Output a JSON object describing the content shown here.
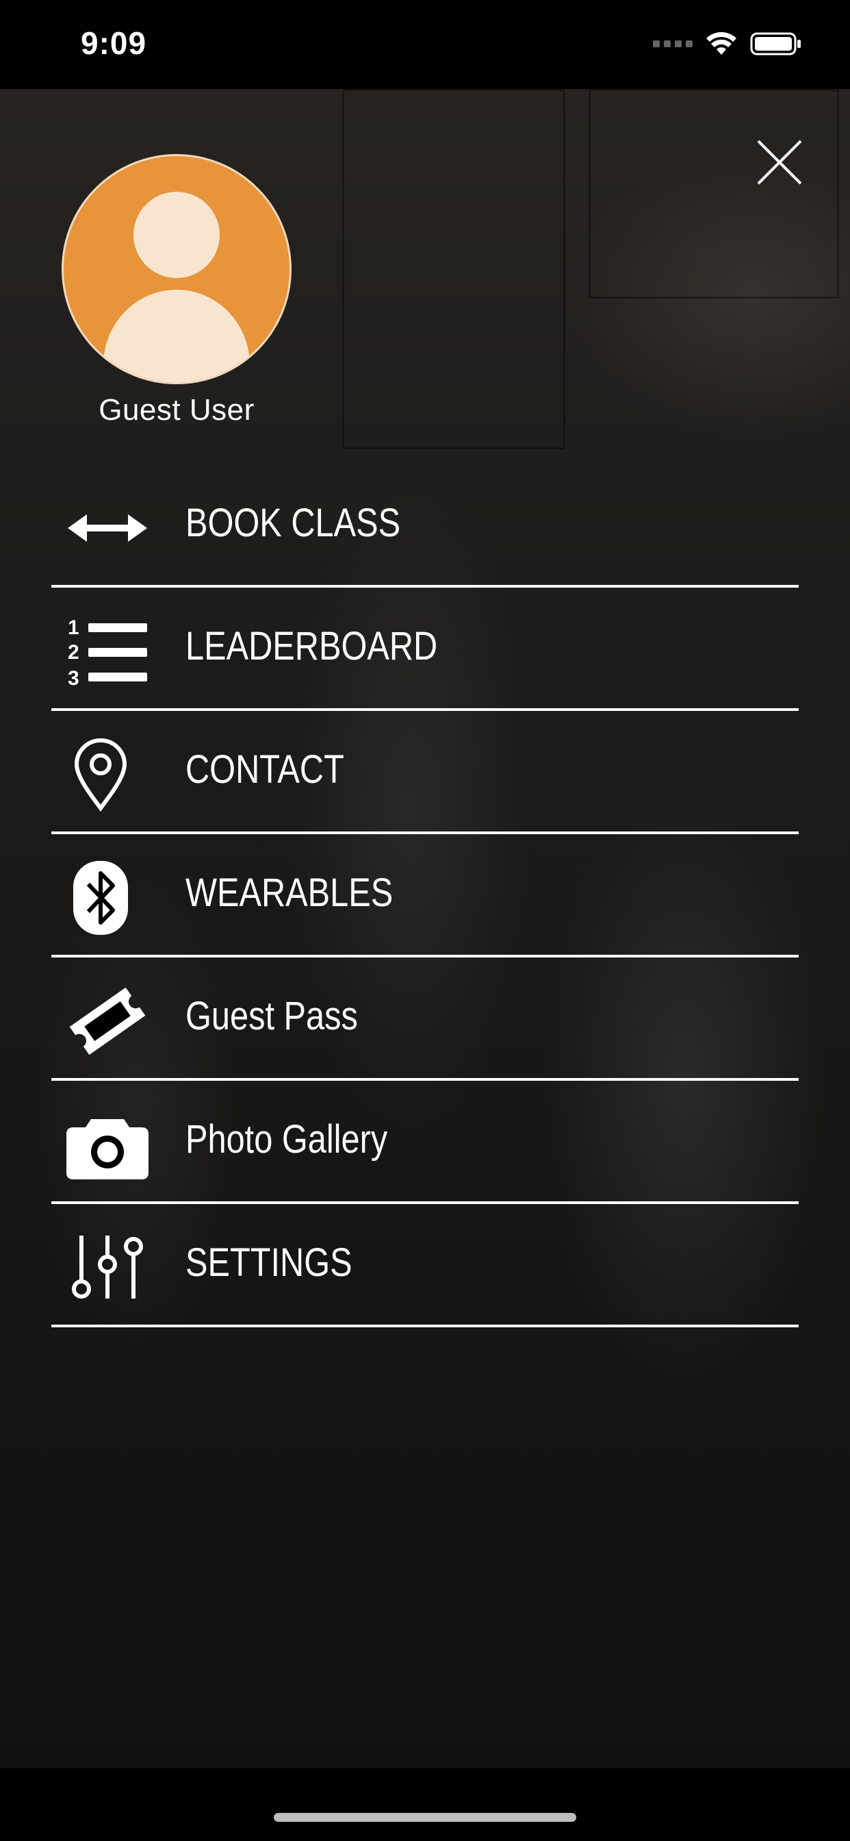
{
  "status_bar": {
    "time": "9:09",
    "icons": [
      "signal-icon",
      "wifi-icon",
      "battery-icon"
    ]
  },
  "drawer": {
    "close_icon": "close-icon",
    "user": {
      "avatar_icon": "user-avatar-icon",
      "avatar_color": "#e8943a",
      "name": "Guest User"
    },
    "menu": [
      {
        "label": "BOOK CLASS",
        "icon": "arrows-horizontal-icon"
      },
      {
        "label": "LEADERBOARD",
        "icon": "numbered-list-icon"
      },
      {
        "label": "CONTACT",
        "icon": "map-pin-icon"
      },
      {
        "label": "WEARABLES",
        "icon": "bluetooth-icon"
      },
      {
        "label": "Guest Pass",
        "icon": "ticket-icon"
      },
      {
        "label": "Photo Gallery",
        "icon": "camera-icon"
      },
      {
        "label": "SETTINGS",
        "icon": "sliders-icon"
      }
    ]
  }
}
